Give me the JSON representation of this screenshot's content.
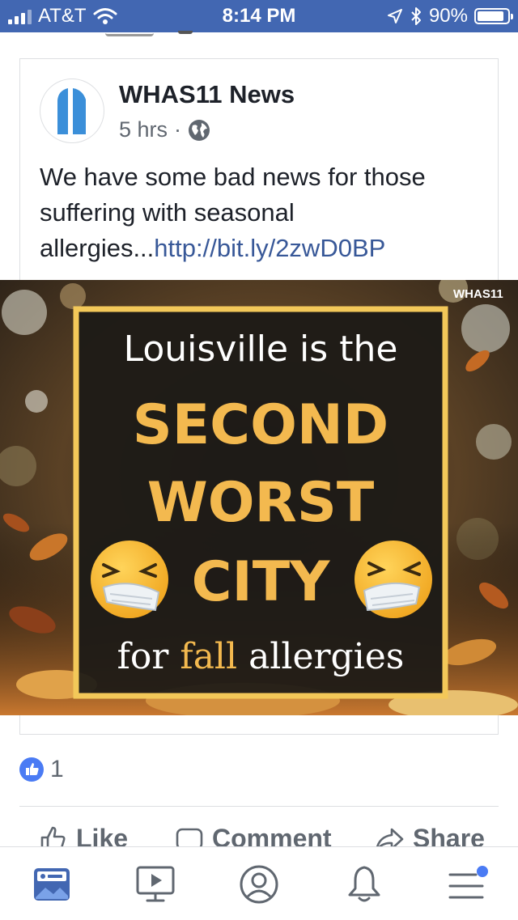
{
  "status_bar": {
    "carrier": "AT&T",
    "time": "8:14 PM",
    "battery": "90%"
  },
  "post": {
    "page_name": "WHAS11 News",
    "time_ago": "5 hrs",
    "separator": "·",
    "text": "We have some bad news for those suffering with seasonal allergies...",
    "link": "http://bit.ly/2zwD0BP",
    "image": {
      "watermark": "WHAS11",
      "line1": "Louisville is the",
      "line2": "SECOND",
      "line3": "WORST",
      "line4": "CITY",
      "line5_a": "for ",
      "line5_b": "fall",
      "line5_c": " allergies"
    },
    "reaction_count": "1"
  },
  "actions": {
    "like": "Like",
    "comment": "Comment",
    "share": "Share"
  },
  "tabs": [
    "news-feed",
    "watch",
    "profile",
    "notifications",
    "menu"
  ],
  "colors": {
    "facebook_blue": "#4267b2",
    "link": "#385898",
    "headline_yellow": "#f3b94f"
  }
}
